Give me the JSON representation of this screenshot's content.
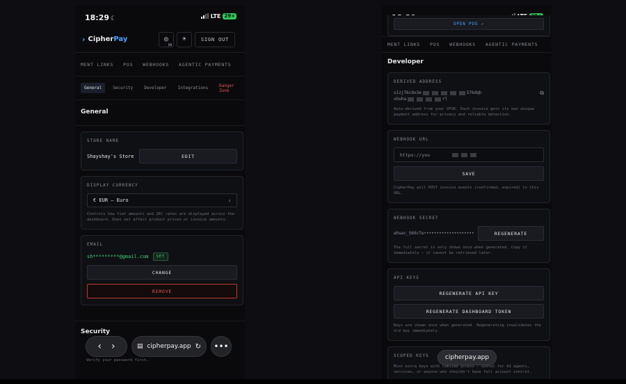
{
  "status": {
    "time": "18:29",
    "network": "LTE",
    "battery": "29+"
  },
  "header": {
    "brand_a": "Cipher",
    "brand_b": "Pay",
    "lang": "EN",
    "sign_out": "SIGN OUT"
  },
  "left_nav": [
    "MENT LINKS",
    "POS",
    "WEBHOOKS",
    "AGENTIC PAYMENTS"
  ],
  "subtabs": [
    "General",
    "Security",
    "Developer",
    "Integrations",
    "Danger Zone"
  ],
  "general": {
    "title": "General",
    "store_label": "STORE NAME",
    "store_name": "Shayshay's Store",
    "edit": "EDIT",
    "currency_label": "DISPLAY CURRENCY",
    "currency_value": "€ EUR — Euro",
    "currency_help": "Controls how fiat amounts and ZEC rates are displayed across the dashboard. Does not affect product prices or invoice amounts.",
    "email_label": "EMAIL",
    "email_value": "sh*********@gmail.com",
    "email_badge": "SET",
    "change": "CHANGE",
    "remove": "REMOVE"
  },
  "security": {
    "title": "Security",
    "peek": "Verify your password first."
  },
  "browser_bar": {
    "url": "cipherpay.app"
  },
  "right": {
    "open_pos": "OPEN POS ↗",
    "nav": [
      "MENT LINKS",
      "POS",
      "WEBHOOKS",
      "AGENTIC PAYMENTS"
    ],
    "developer_title": "Developer",
    "derived_label": "DERIVED ADDRESS",
    "derived_line1": "u1zj76cdx3e",
    "derived_line1_end": "576dqh",
    "derived_line2": "xhuha",
    "derived_line2_end": "rl",
    "derived_help": "Auto-derived from your UFVK. Each invoice gets its own unique payment address for privacy and reliable detection.",
    "webhook_url_label": "WEBHOOK URL",
    "webhook_url_value": "https://you",
    "save": "SAVE",
    "webhook_help": "CipherPay will POST invoice events (confirmed, expired) to this URL.",
    "secret_label": "WEBHOOK SECRET",
    "secret_value": "whsec_560cfe••••••••••••••••••••",
    "regenerate": "REGENERATE",
    "secret_help": "The full secret is only shown once when generated. Copy it immediately — it cannot be retrieved later.",
    "api_label": "API KEYS",
    "regen_api": "REGENERATE API KEY",
    "regen_dash": "REGENERATE DASHBOARD TOKEN",
    "api_help": "Keys are shown once when generated. Regenerating invalidates the old key immediately.",
    "scoped_label": "SCOPED KEYS",
    "scoped_help": "Mint extra keys with limited access — useful for AI agents, services, or anyone who shouldn't have full account control."
  },
  "colors": {
    "accent": "#4aa3ff",
    "success": "#42d17a",
    "danger": "#e25555",
    "battery": "#34c759"
  }
}
